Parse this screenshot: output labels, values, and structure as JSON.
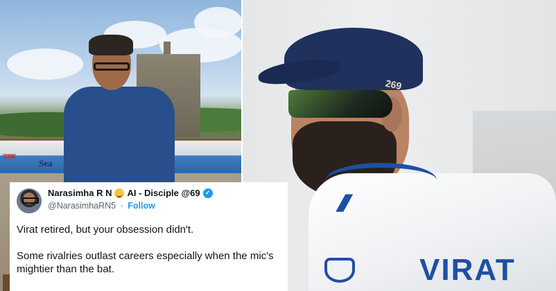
{
  "left_photo": {
    "boat_text": "Sea",
    "boat_text_small": "तडक"
  },
  "right_photo": {
    "cap_number": "269",
    "jersey_name": "VIRAT"
  },
  "tweet": {
    "display_name": "Narasimha R N",
    "display_name_suffix": "AI - Disciple @69",
    "emoji": "hug-emoji",
    "handle": "@NarasimhaRN5",
    "separator": "·",
    "follow_label": "Follow",
    "paragraphs": [
      "Virat retired, but your obsession didn't.",
      "Some rivalries outlast careers especially when the mic's mightier than the bat."
    ],
    "verified_color": "#1d9bf0",
    "follow_color": "#1d9bf0"
  }
}
